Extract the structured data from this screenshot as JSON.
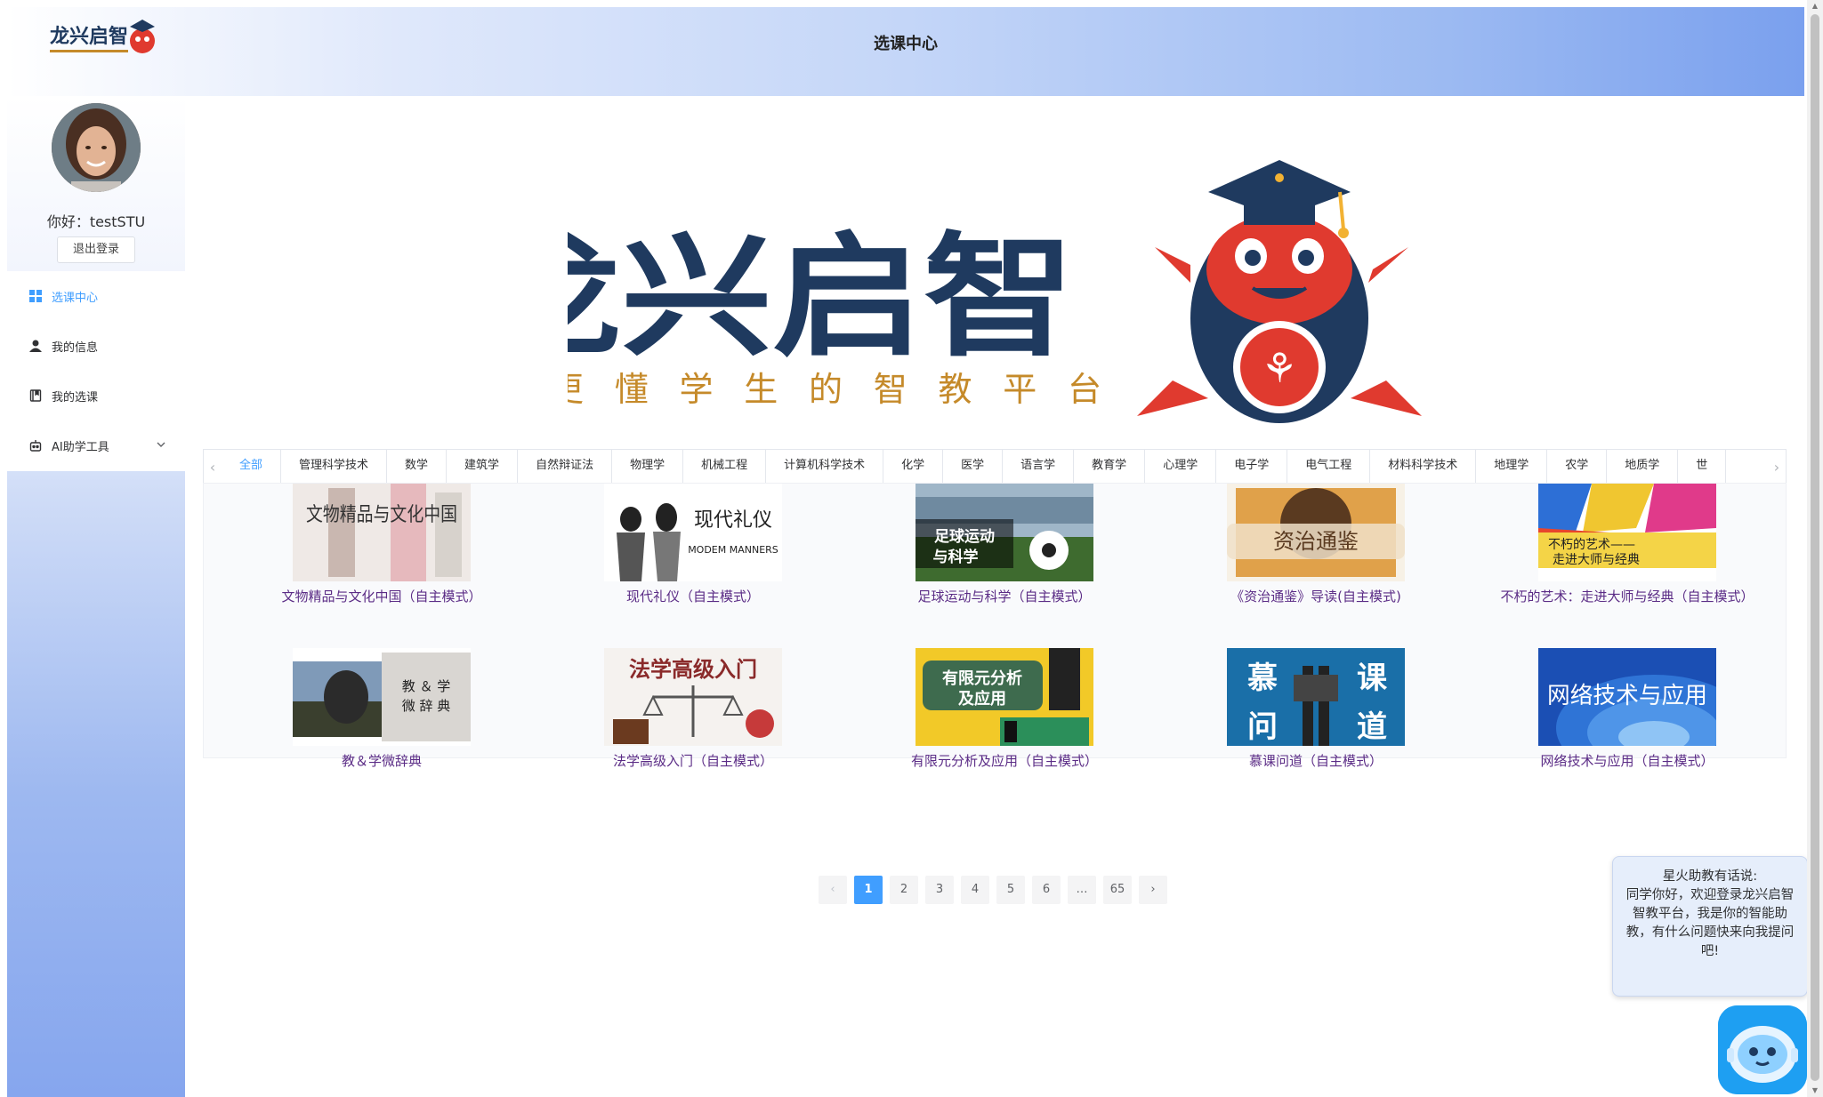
{
  "header": {
    "title": "选课中心",
    "logo_text": "龙兴启智"
  },
  "sidebar": {
    "greeting": "你好：testSTU",
    "logout_label": "退出登录",
    "menu": [
      {
        "label": "选课中心",
        "icon": "grid-icon",
        "active": true
      },
      {
        "label": "我的信息",
        "icon": "user-icon",
        "active": false
      },
      {
        "label": "我的选课",
        "icon": "book-icon",
        "active": false
      },
      {
        "label": "AI助学工具",
        "icon": "robot-icon",
        "active": false,
        "expandable": true
      }
    ]
  },
  "banner": {
    "title": "龙兴启智",
    "slogan": "更 懂 学 生 的 智 教 平 台"
  },
  "categories": [
    "全部",
    "管理科学技术",
    "数学",
    "建筑学",
    "自然辩证法",
    "物理学",
    "机械工程",
    "计算机科学技术",
    "化学",
    "医学",
    "语言学",
    "教育学",
    "心理学",
    "电子学",
    "电气工程",
    "材料科学技术",
    "地理学",
    "农学",
    "地质学",
    "世"
  ],
  "active_category": "全部",
  "courses": [
    {
      "name": "文物精品与文化中国（自主模式）",
      "thumb_text": "文物精品与文化中国"
    },
    {
      "name": "现代礼仪（自主模式）",
      "thumb_text": "现代礼仪",
      "thumb_sub": "MODEM MANNERS"
    },
    {
      "name": "足球运动与科学（自主模式）",
      "thumb_text": "足球运动与科学"
    },
    {
      "name": "《资治通鉴》导读(自主模式)",
      "thumb_text": "资治通鉴"
    },
    {
      "name": "不朽的艺术：走进大师与经典（自主模式）",
      "thumb_text": "不朽的艺术——走进大师与经典"
    },
    {
      "name": "教＆学微辞典",
      "thumb_text": "教＆学微辞典"
    },
    {
      "name": "法学高级入门（自主模式）",
      "thumb_text": "法学高级入门"
    },
    {
      "name": "有限元分析及应用（自主模式）",
      "thumb_text": "有限元分析及应用"
    },
    {
      "name": "慕课问道（自主模式）",
      "thumb_text": "慕 课 问 道"
    },
    {
      "name": "网络技术与应用（自主模式）",
      "thumb_text": "网络技术与应用"
    }
  ],
  "pagination": {
    "pages": [
      "1",
      "2",
      "3",
      "4",
      "5",
      "6",
      "…",
      "65"
    ],
    "current": "1",
    "prev": "‹",
    "next": "›"
  },
  "assistant": {
    "message_title": "星火助教有话说:",
    "message_body": "同学你好，欢迎登录龙兴启智智教平台，我是你的智能助教，有什么问题快来向我提问吧!"
  },
  "colors": {
    "accent": "#409eff",
    "course_name": "#5b2c86",
    "brand_navy": "#1f3a5f",
    "brand_gold": "#c58a2a",
    "brand_red": "#e03a2f"
  }
}
